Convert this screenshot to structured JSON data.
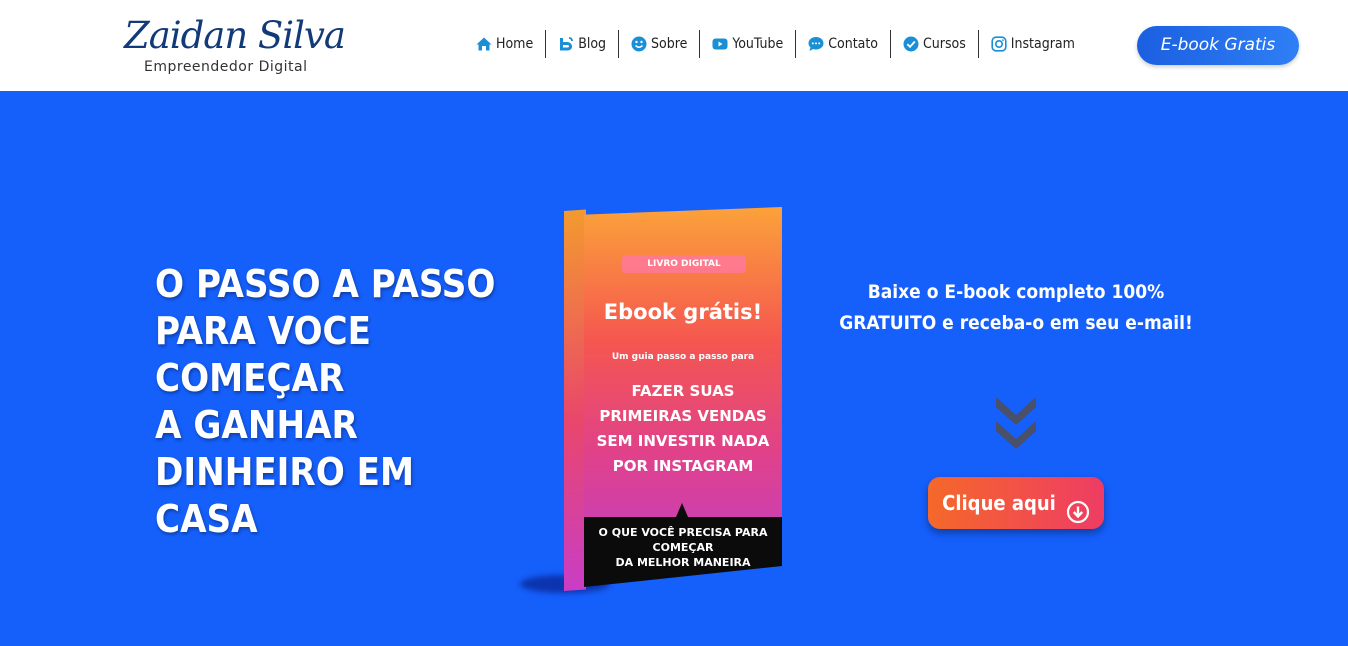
{
  "header": {
    "logo_name": "Zaidan Silva",
    "logo_subtitle": "Empreendedor Digital",
    "nav": [
      {
        "label": "Home",
        "icon": "home-icon"
      },
      {
        "label": "Blog",
        "icon": "blogger-icon"
      },
      {
        "label": "Sobre",
        "icon": "smile-icon"
      },
      {
        "label": "YouTube",
        "icon": "youtube-icon"
      },
      {
        "label": "Contato",
        "icon": "chat-icon"
      },
      {
        "label": "Cursos",
        "icon": "check-circle-icon"
      },
      {
        "label": "Instagram",
        "icon": "instagram-icon"
      }
    ],
    "cta_label": "E-book Gratis"
  },
  "hero": {
    "headline_lines": [
      "O PASSO A PASSO",
      "PARA VOCE",
      "COMEÇAR",
      "A GANHAR",
      "DINHEIRO EM",
      "CASA"
    ],
    "book": {
      "tag": "LIVRO DIGITAL",
      "title": "Ebook grátis!",
      "guide": "Um guia passo a passo para",
      "big_lines": [
        "FAZER SUAS",
        "PRIMEIRAS VENDAS",
        "SEM INVESTIR NADA",
        "POR INSTAGRAM"
      ],
      "bottom_lines": [
        "O QUE VOCÊ PRECISA PARA",
        "COMEÇAR",
        "DA MELHOR MANEIRA"
      ]
    },
    "cta_text": "Baixe o E-book completo 100% GRATUITO e receba-o em seu e-mail!",
    "button_label": "Clique aqui",
    "button_icon": "arrow-down-circle-icon",
    "down_icon": "double-chevron-down-icon"
  },
  "colors": {
    "hero_bg": "#155ffb",
    "icon_blue": "#1a8fd6",
    "logo_blue": "#123a78",
    "button_orange": "#f5682a",
    "button_pink": "#ee3c64"
  }
}
